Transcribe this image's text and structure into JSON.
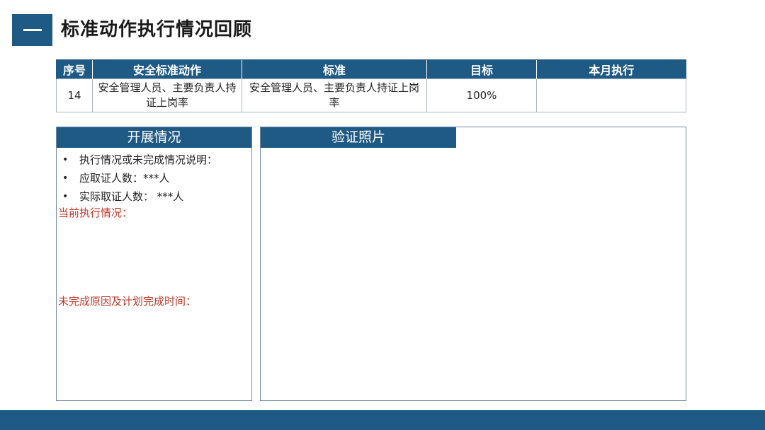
{
  "header": {
    "title": "标准动作执行情况回顾"
  },
  "table": {
    "headers": [
      "序号",
      "安全标准动作",
      "标准",
      "目标",
      "本月执行"
    ],
    "rows": [
      [
        "14",
        "安全管理人员、主要负责人持证上岗率",
        "安全管理人员、主要负责人持证上岗率",
        "100%",
        ""
      ]
    ]
  },
  "left_panel": {
    "title": "开展情况",
    "bullets": [
      "执行情况或未完成情况说明：",
      "应取证人数：***人",
      "实际取证人数：  ***人"
    ],
    "current_label": "当前执行情况：",
    "reason_label": "未完成原因及计划完成时间："
  },
  "right_panel": {
    "title": "验证照片"
  },
  "colors": {
    "brand": "#1f5a84",
    "alert": "#c0392b"
  }
}
